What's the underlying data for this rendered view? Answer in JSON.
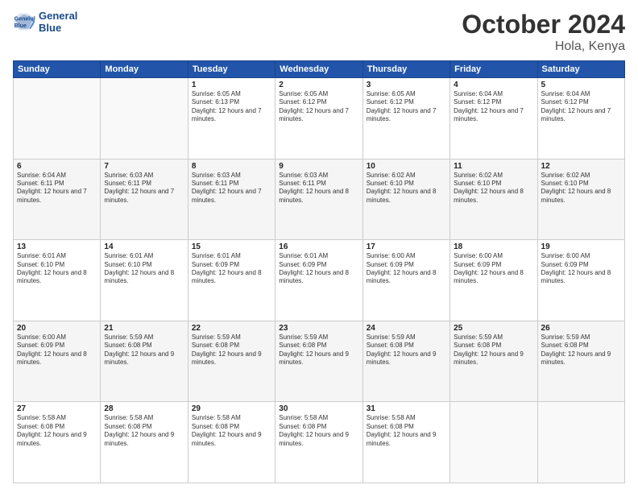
{
  "logo": {
    "line1": "General",
    "line2": "Blue"
  },
  "header": {
    "month": "October 2024",
    "location": "Hola, Kenya"
  },
  "weekdays": [
    "Sunday",
    "Monday",
    "Tuesday",
    "Wednesday",
    "Thursday",
    "Friday",
    "Saturday"
  ],
  "weeks": [
    [
      {
        "day": "",
        "info": ""
      },
      {
        "day": "",
        "info": ""
      },
      {
        "day": "1",
        "info": "Sunrise: 6:05 AM\nSunset: 6:13 PM\nDaylight: 12 hours and 7 minutes."
      },
      {
        "day": "2",
        "info": "Sunrise: 6:05 AM\nSunset: 6:12 PM\nDaylight: 12 hours and 7 minutes."
      },
      {
        "day": "3",
        "info": "Sunrise: 6:05 AM\nSunset: 6:12 PM\nDaylight: 12 hours and 7 minutes."
      },
      {
        "day": "4",
        "info": "Sunrise: 6:04 AM\nSunset: 6:12 PM\nDaylight: 12 hours and 7 minutes."
      },
      {
        "day": "5",
        "info": "Sunrise: 6:04 AM\nSunset: 6:12 PM\nDaylight: 12 hours and 7 minutes."
      }
    ],
    [
      {
        "day": "6",
        "info": "Sunrise: 6:04 AM\nSunset: 6:11 PM\nDaylight: 12 hours and 7 minutes."
      },
      {
        "day": "7",
        "info": "Sunrise: 6:03 AM\nSunset: 6:11 PM\nDaylight: 12 hours and 7 minutes."
      },
      {
        "day": "8",
        "info": "Sunrise: 6:03 AM\nSunset: 6:11 PM\nDaylight: 12 hours and 7 minutes."
      },
      {
        "day": "9",
        "info": "Sunrise: 6:03 AM\nSunset: 6:11 PM\nDaylight: 12 hours and 8 minutes."
      },
      {
        "day": "10",
        "info": "Sunrise: 6:02 AM\nSunset: 6:10 PM\nDaylight: 12 hours and 8 minutes."
      },
      {
        "day": "11",
        "info": "Sunrise: 6:02 AM\nSunset: 6:10 PM\nDaylight: 12 hours and 8 minutes."
      },
      {
        "day": "12",
        "info": "Sunrise: 6:02 AM\nSunset: 6:10 PM\nDaylight: 12 hours and 8 minutes."
      }
    ],
    [
      {
        "day": "13",
        "info": "Sunrise: 6:01 AM\nSunset: 6:10 PM\nDaylight: 12 hours and 8 minutes."
      },
      {
        "day": "14",
        "info": "Sunrise: 6:01 AM\nSunset: 6:10 PM\nDaylight: 12 hours and 8 minutes."
      },
      {
        "day": "15",
        "info": "Sunrise: 6:01 AM\nSunset: 6:09 PM\nDaylight: 12 hours and 8 minutes."
      },
      {
        "day": "16",
        "info": "Sunrise: 6:01 AM\nSunset: 6:09 PM\nDaylight: 12 hours and 8 minutes."
      },
      {
        "day": "17",
        "info": "Sunrise: 6:00 AM\nSunset: 6:09 PM\nDaylight: 12 hours and 8 minutes."
      },
      {
        "day": "18",
        "info": "Sunrise: 6:00 AM\nSunset: 6:09 PM\nDaylight: 12 hours and 8 minutes."
      },
      {
        "day": "19",
        "info": "Sunrise: 6:00 AM\nSunset: 6:09 PM\nDaylight: 12 hours and 8 minutes."
      }
    ],
    [
      {
        "day": "20",
        "info": "Sunrise: 6:00 AM\nSunset: 6:09 PM\nDaylight: 12 hours and 8 minutes."
      },
      {
        "day": "21",
        "info": "Sunrise: 5:59 AM\nSunset: 6:08 PM\nDaylight: 12 hours and 9 minutes."
      },
      {
        "day": "22",
        "info": "Sunrise: 5:59 AM\nSunset: 6:08 PM\nDaylight: 12 hours and 9 minutes."
      },
      {
        "day": "23",
        "info": "Sunrise: 5:59 AM\nSunset: 6:08 PM\nDaylight: 12 hours and 9 minutes."
      },
      {
        "day": "24",
        "info": "Sunrise: 5:59 AM\nSunset: 6:08 PM\nDaylight: 12 hours and 9 minutes."
      },
      {
        "day": "25",
        "info": "Sunrise: 5:59 AM\nSunset: 6:08 PM\nDaylight: 12 hours and 9 minutes."
      },
      {
        "day": "26",
        "info": "Sunrise: 5:59 AM\nSunset: 6:08 PM\nDaylight: 12 hours and 9 minutes."
      }
    ],
    [
      {
        "day": "27",
        "info": "Sunrise: 5:58 AM\nSunset: 6:08 PM\nDaylight: 12 hours and 9 minutes."
      },
      {
        "day": "28",
        "info": "Sunrise: 5:58 AM\nSunset: 6:08 PM\nDaylight: 12 hours and 9 minutes."
      },
      {
        "day": "29",
        "info": "Sunrise: 5:58 AM\nSunset: 6:08 PM\nDaylight: 12 hours and 9 minutes."
      },
      {
        "day": "30",
        "info": "Sunrise: 5:58 AM\nSunset: 6:08 PM\nDaylight: 12 hours and 9 minutes."
      },
      {
        "day": "31",
        "info": "Sunrise: 5:58 AM\nSunset: 6:08 PM\nDaylight: 12 hours and 9 minutes."
      },
      {
        "day": "",
        "info": ""
      },
      {
        "day": "",
        "info": ""
      }
    ]
  ]
}
